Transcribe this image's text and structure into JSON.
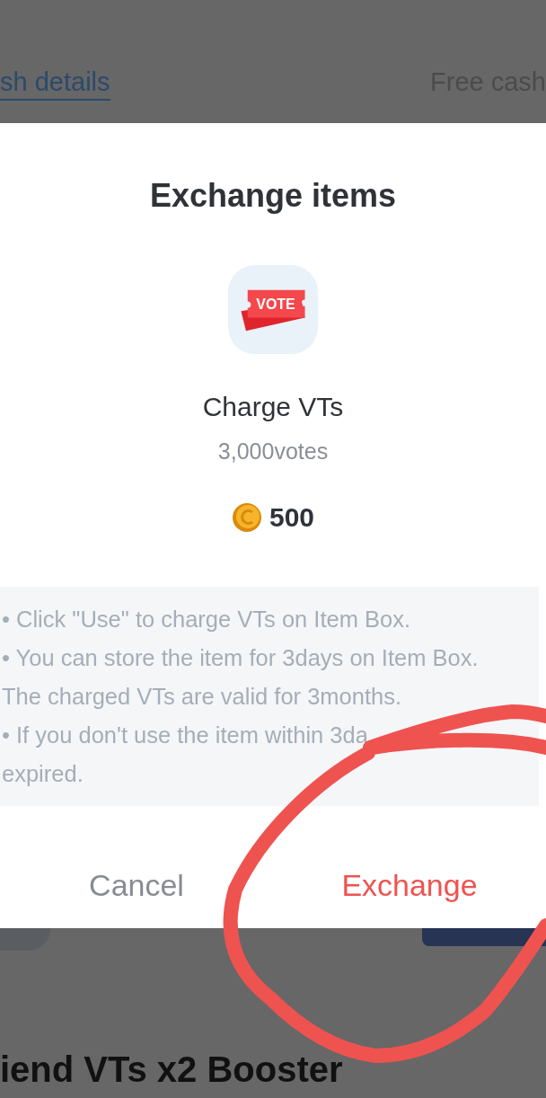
{
  "background": {
    "tabs": [
      {
        "label": "sh details",
        "selected": true
      },
      {
        "label": "Free cash",
        "selected": false
      }
    ],
    "section_title": "iend VTs x2 Booster"
  },
  "dialog": {
    "title": "Exchange items",
    "item": {
      "icon_label": "VOTE",
      "name": "Charge VTs",
      "amount": "3,000votes",
      "price": "500"
    },
    "notes": [
      "• Click \"Use\" to charge VTs on Item Box.",
      "• You can store the item for 3days on Item Box. The charged VTs are valid for 3months.",
      "• If you don't use the item within 3da",
      "expired."
    ],
    "buttons": [
      {
        "label": "Cancel",
        "kind": "cancel"
      },
      {
        "label": "Exchange",
        "kind": "confirm"
      }
    ]
  }
}
